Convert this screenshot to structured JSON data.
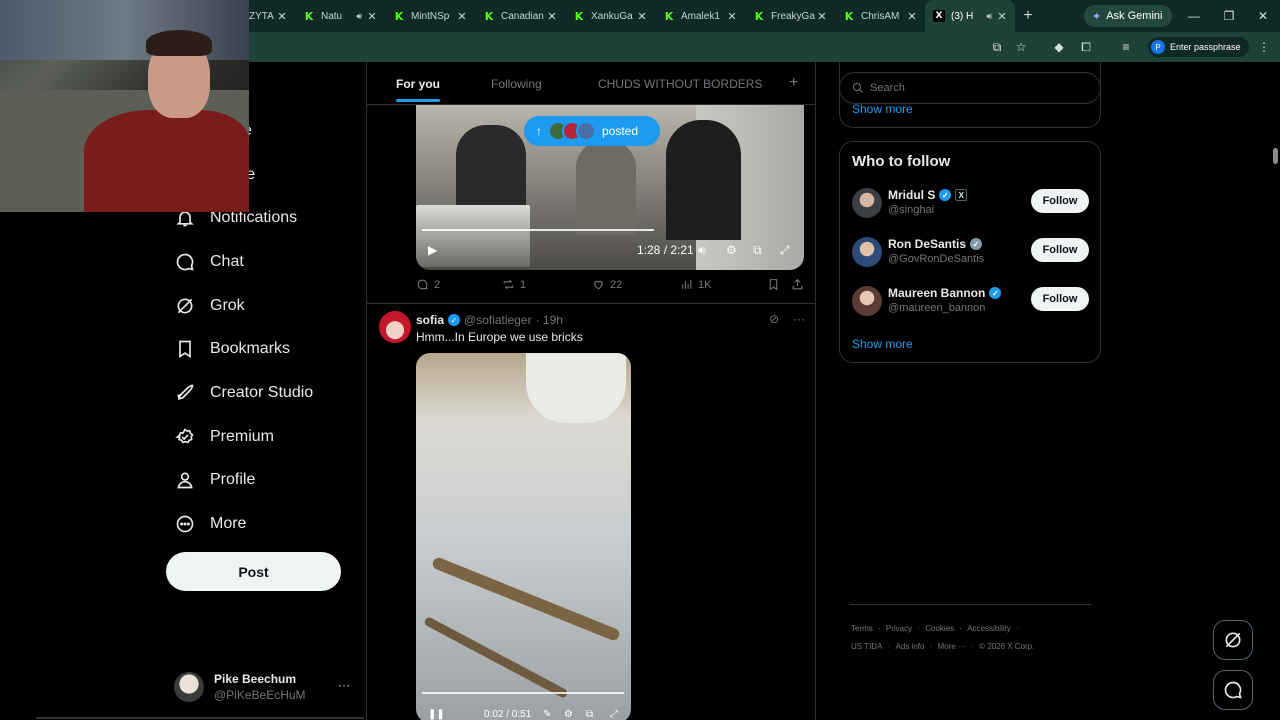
{
  "browser": {
    "tabs": [
      {
        "title": "ZYTA",
        "icon": "kick-icon"
      },
      {
        "title": "Natu",
        "icon": "kick-icon",
        "audio": true
      },
      {
        "title": "MintNSp",
        "icon": "kick-icon"
      },
      {
        "title": "Canadian",
        "icon": "kick-icon"
      },
      {
        "title": "XankuGa",
        "icon": "kick-icon"
      },
      {
        "title": "Amalek1",
        "icon": "kick-icon"
      },
      {
        "title": "FreakyGa",
        "icon": "kick-icon"
      },
      {
        "title": "ChrisAM",
        "icon": "kick-icon"
      },
      {
        "title": "(3) H",
        "icon": "x-icon",
        "audio": true,
        "active": true
      }
    ],
    "gemini_label": "Ask Gemini",
    "passphrase_label": "Enter passphrase",
    "passphrase_avatar": "P",
    "new_tab_symbol": "+"
  },
  "nav": {
    "items": [
      {
        "label": "Notifications",
        "icon": "bell-icon"
      },
      {
        "label": "Chat",
        "icon": "chat-icon"
      },
      {
        "label": "Grok",
        "icon": "grok-icon"
      },
      {
        "label": "Bookmarks",
        "icon": "bookmark-icon"
      },
      {
        "label": "Creator Studio",
        "icon": "rocket-icon"
      },
      {
        "label": "Premium",
        "icon": "premium-icon"
      },
      {
        "label": "Profile",
        "icon": "person-icon"
      },
      {
        "label": "More",
        "icon": "more-circle-icon"
      }
    ],
    "partial_labels": [
      "e",
      "re"
    ],
    "post_label": "Post"
  },
  "account": {
    "name": "Pike Beechum",
    "handle": "@PiKeBeEcHuM",
    "menu": "···"
  },
  "feed": {
    "tabs": [
      {
        "label": "For you",
        "active": true
      },
      {
        "label": "Following"
      },
      {
        "label": "CHUDS WITHOUT BORDERS"
      }
    ],
    "add_tab": "+",
    "posted_pill": "posted",
    "post1": {
      "video_time": "1:28 / 2:21",
      "replies": "2",
      "reposts": "1",
      "likes": "22",
      "views": "1K"
    },
    "post2": {
      "name": "sofia",
      "handle": "@sofiatieger",
      "time": "· 19h",
      "text": "Hmm...In Europe we use bricks",
      "video_time": "0:02 / 0:51"
    }
  },
  "sidebar": {
    "search_placeholder": "Search",
    "prev_show_more": "Show more",
    "who_to_follow": {
      "title": "Who to follow",
      "users": [
        {
          "name": "Mridul S",
          "handle": "@singhai",
          "verified": "blue",
          "x_badge": "X",
          "avatar_color": "#3b3f44"
        },
        {
          "name": "Ron DeSantis",
          "handle": "@GovRonDeSantis",
          "verified": "gray",
          "avatar_color": "#2c4a7a"
        },
        {
          "name": "Maureen Bannon",
          "handle": "@maureen_bannon",
          "verified": "blue",
          "avatar_color": "#5a3c35"
        }
      ],
      "follow_label": "Follow",
      "show_more": "Show more"
    },
    "footer": {
      "row1": [
        "Terms",
        "Privacy",
        "Cookies",
        "Accessibility"
      ],
      "row2": [
        "US TIDA",
        "Ads info",
        "More ···",
        "© 2026 X Corp."
      ]
    }
  },
  "colors": {
    "accent": "#1d9bf0",
    "chrome": "#1e4138",
    "tabstrip": "#0f2a24",
    "kick": "#53fc18"
  }
}
